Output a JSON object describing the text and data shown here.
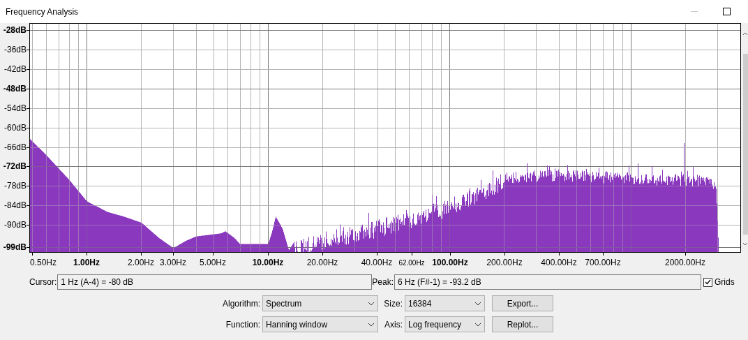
{
  "window": {
    "title": "Frequency Analysis",
    "minimize_disabled": true
  },
  "plot": {
    "y_axis_labels": [
      {
        "text": "-28dB",
        "bold": true
      },
      {
        "text": "-36dB",
        "bold": false
      },
      {
        "text": "-42dB",
        "bold": false
      },
      {
        "text": "-48dB",
        "bold": true
      },
      {
        "text": "-54dB",
        "bold": false
      },
      {
        "text": "-60dB",
        "bold": false
      },
      {
        "text": "-66dB",
        "bold": false
      },
      {
        "text": "-72dB",
        "bold": true
      },
      {
        "text": "-78dB",
        "bold": false
      },
      {
        "text": "-84dB",
        "bold": false
      },
      {
        "text": "-90dB",
        "bold": false
      },
      {
        "text": "-99dB",
        "bold": true
      }
    ],
    "x_axis_labels": [
      {
        "text": "0.50Hz",
        "kind": "normal"
      },
      {
        "text": "1.00Hz",
        "kind": "bold"
      },
      {
        "text": "2.00Hz",
        "kind": "normal"
      },
      {
        "text": "3.00Hz",
        "kind": "normal"
      },
      {
        "text": "5.00Hz",
        "kind": "normal"
      },
      {
        "text": "10.00Hz",
        "kind": "bold"
      },
      {
        "text": "20.00Hz",
        "kind": "normal"
      },
      {
        "text": "40.00Hz",
        "kind": "normal"
      },
      {
        "text": "62.00Hz",
        "kind": "small"
      },
      {
        "text": "100.00Hz",
        "kind": "bold"
      },
      {
        "text": "200.00Hz",
        "kind": "normal"
      },
      {
        "text": "400.00Hz",
        "kind": "normal"
      },
      {
        "text": "700.00Hz",
        "kind": "normal"
      },
      {
        "text": "2000.00Hz",
        "kind": "normal"
      }
    ]
  },
  "cursor": {
    "label": "Cursor:",
    "value": "1 Hz (A-4) = -80 dB"
  },
  "peak": {
    "label": "Peak:",
    "value": "6 Hz (F#-1) = -93.2 dB"
  },
  "grids": {
    "label": "Grids",
    "checked": true
  },
  "settings": [
    {
      "label": "Algorithm:",
      "value": "Spectrum",
      "side_label": "Size:",
      "side_value": "16384",
      "button": "Export..."
    },
    {
      "label": "Function:",
      "value": "Hanning window",
      "side_label": "Axis:",
      "side_value": "Log frequency",
      "button": "Replot..."
    }
  ]
}
